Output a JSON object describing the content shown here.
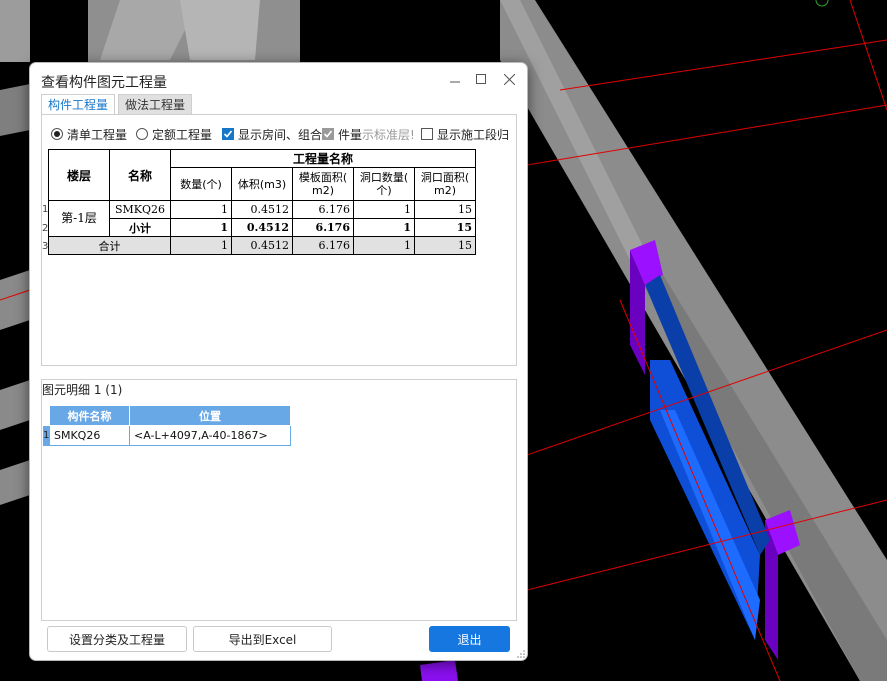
{
  "window": {
    "title": "查看构件图元工程量"
  },
  "tabs": [
    {
      "label": "构件工程量",
      "active": true
    },
    {
      "label": "做法工程量",
      "active": false
    }
  ],
  "options": {
    "bill_qty": "清单工程量",
    "quota_qty": "定额工程量",
    "show_rooms": "显示房间、组合",
    "overlap_fragment": "件量",
    "show_std_floor": "示标准层!",
    "show_stage": "显示施工段归"
  },
  "quantity_table": {
    "headers": {
      "floor": "楼层",
      "name": "名称",
      "group": "工程量名称",
      "count": "数量(个)",
      "volume": "体积(m3)",
      "formwork": "模板面积(\nm2)",
      "openings": "洞口数量(\n个)",
      "opening_area": "洞口面积(\nm2)"
    },
    "row_numbers": [
      "1",
      "2",
      "3"
    ],
    "floor_label": "第-1层",
    "rows": [
      {
        "name": "SMKQ26",
        "count": "1",
        "volume": "0.4512",
        "formwork": "6.176",
        "openings": "1",
        "opening_area": "15"
      },
      {
        "name": "小计",
        "count": "1",
        "volume": "0.4512",
        "formwork": "6.176",
        "openings": "1",
        "opening_area": "15"
      }
    ],
    "total": {
      "label": "合计",
      "count": "1",
      "volume": "0.4512",
      "formwork": "6.176",
      "openings": "1",
      "opening_area": "15"
    }
  },
  "detail": {
    "title": "图元明细  1 (1)",
    "headers": {
      "component": "构件名称",
      "position": "位置"
    },
    "row_number": "1",
    "rows": [
      {
        "component": "SMKQ26",
        "position": "<A-L+4097,A-40-1867>"
      }
    ]
  },
  "buttons": {
    "classify": "设置分类及工程量",
    "export": "导出到Excel",
    "exit": "退出"
  },
  "colors": {
    "accent": "#1677e0",
    "header_blue": "#69a8e6",
    "tab_text": "#1677c9"
  }
}
